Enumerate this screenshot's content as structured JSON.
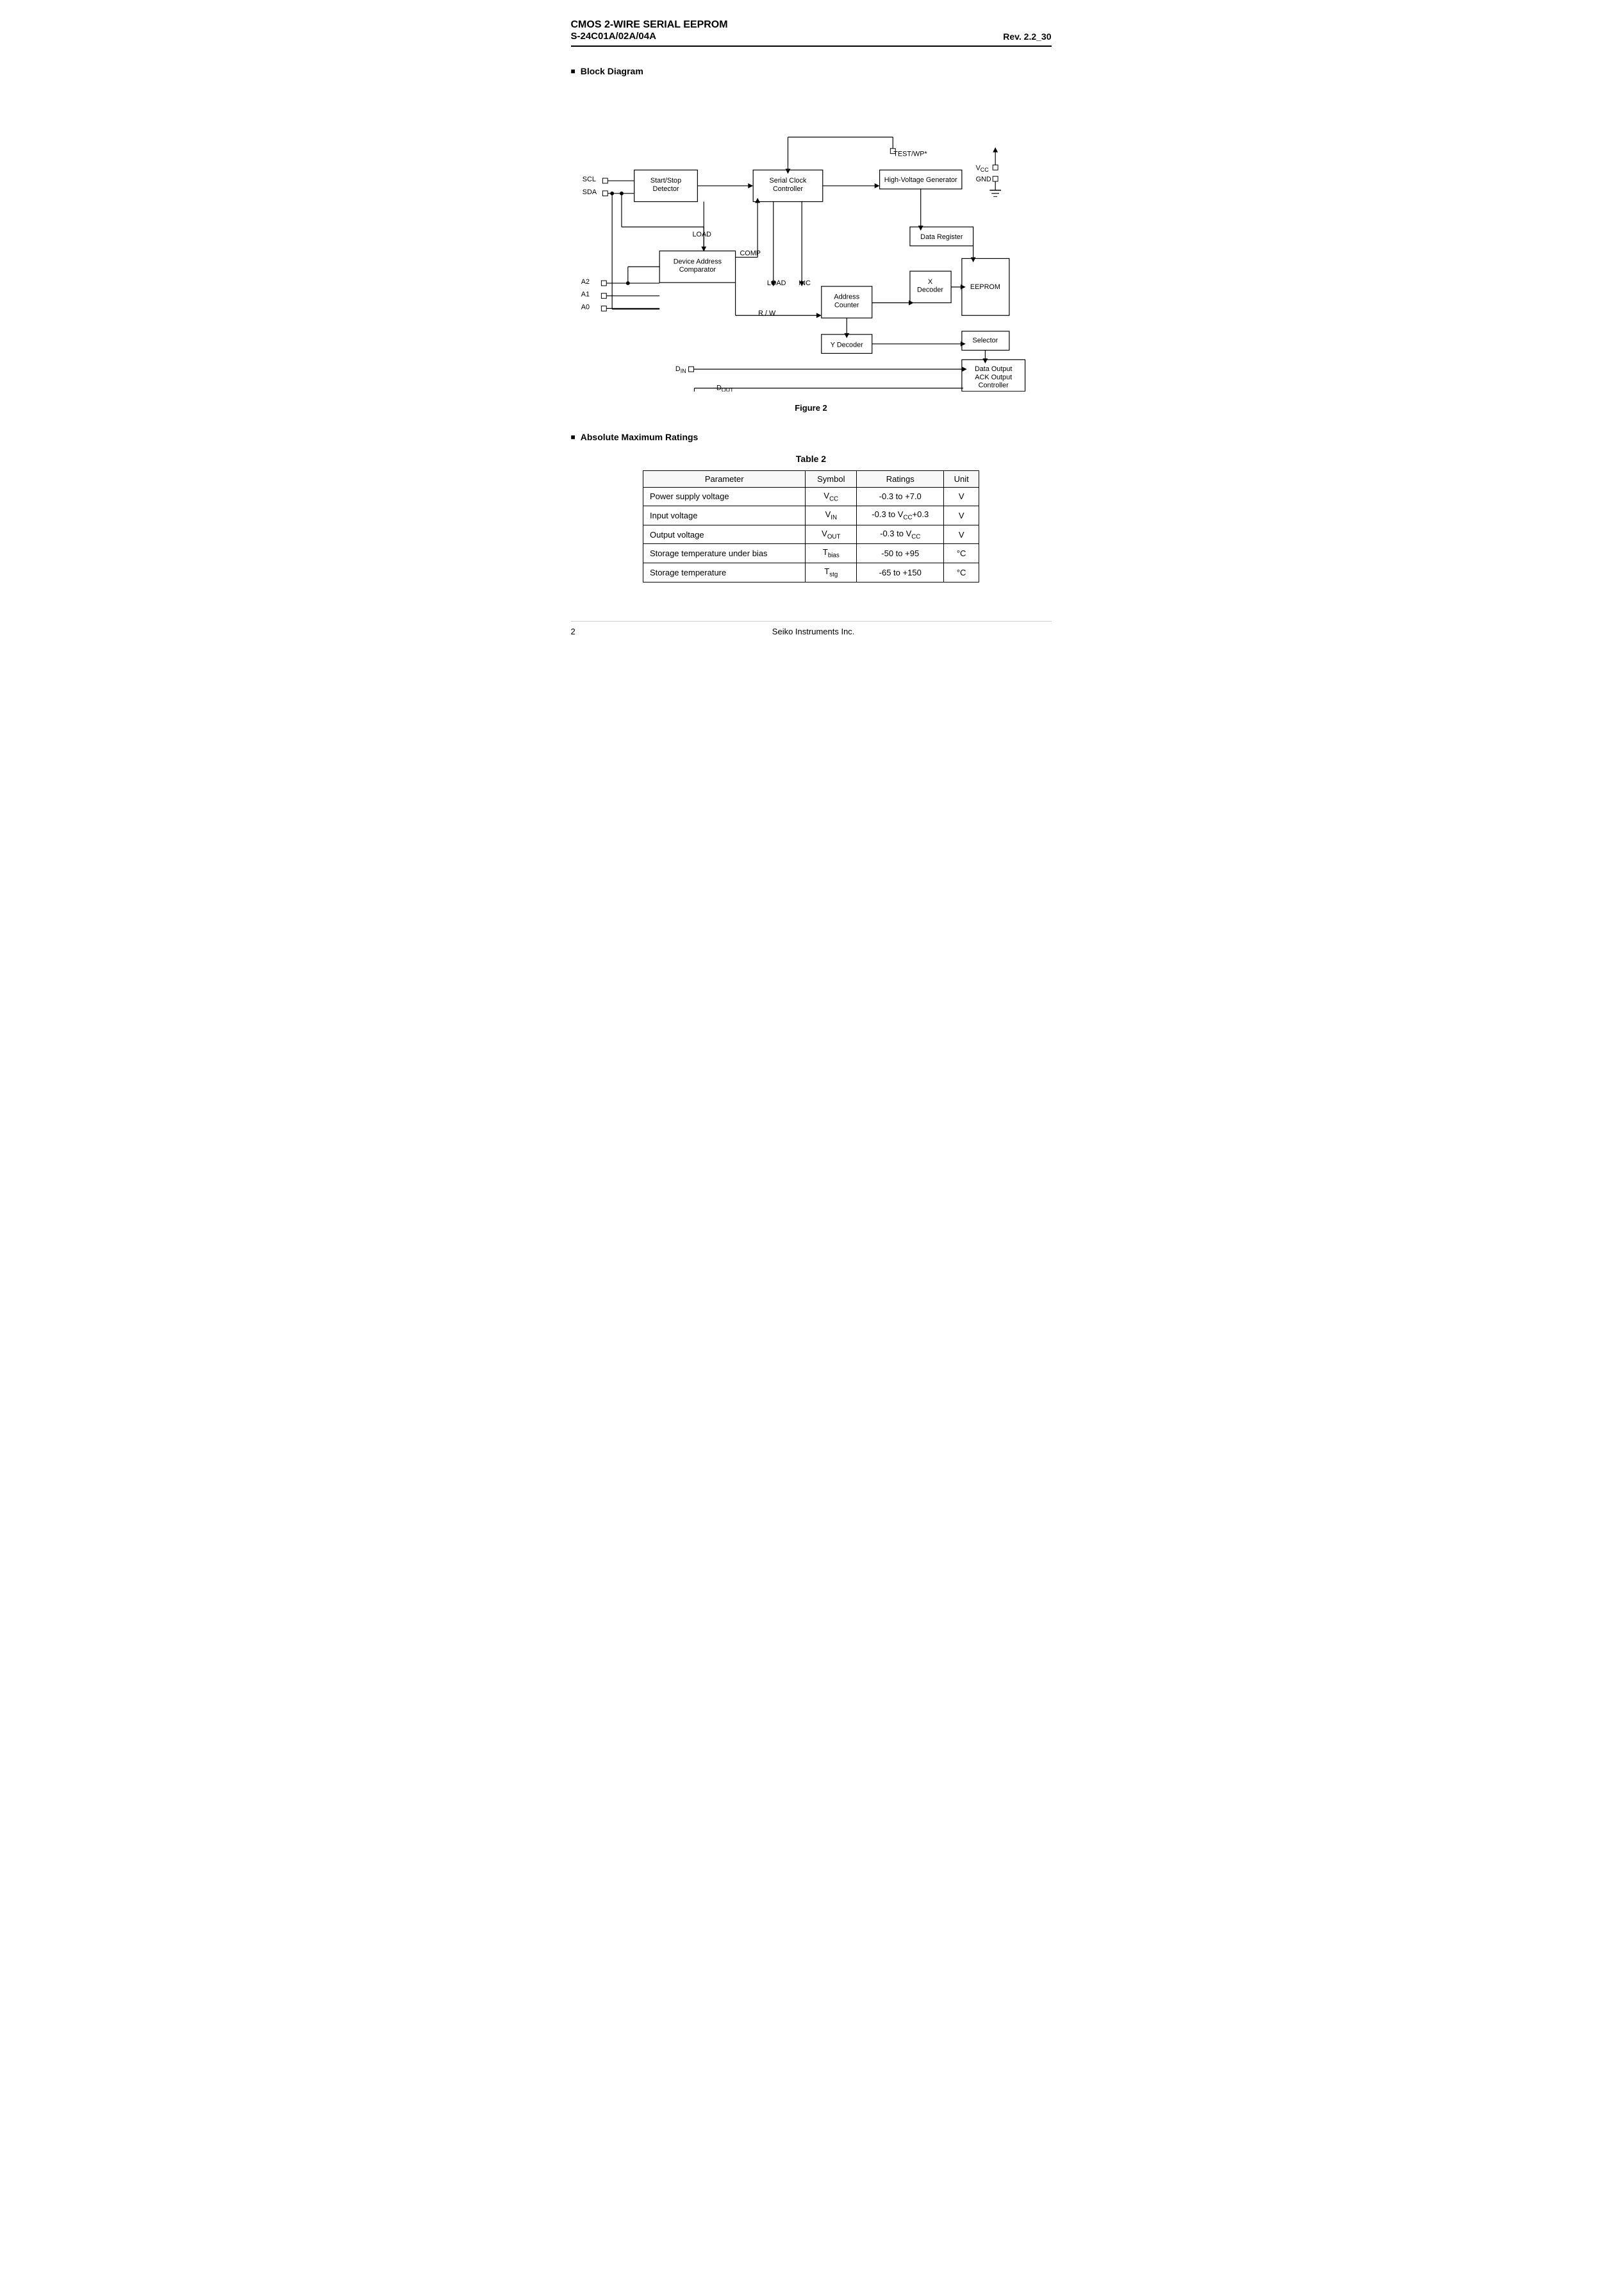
{
  "header": {
    "line1": "CMOS 2-WIRE SERIAL  EEPROM",
    "line2": "S-24C01A/02A/04A",
    "rev": "Rev. 2.2_30"
  },
  "section1": {
    "title": "Block Diagram"
  },
  "figure": {
    "label": "Figure 2"
  },
  "section2": {
    "title": "Absolute Maximum Ratings"
  },
  "table": {
    "label": "Table  2",
    "headers": [
      "Parameter",
      "Symbol",
      "Ratings",
      "Unit"
    ],
    "rows": [
      [
        "Power supply voltage",
        "Vₜc",
        "-0.3 to +7.0",
        "V"
      ],
      [
        "Input voltage",
        "VᴵN",
        "-0.3 to Vₜc+0.3",
        "V"
      ],
      [
        "Output voltage",
        "VₒUT",
        "-0.3 to Vₜc",
        "V"
      ],
      [
        "Storage temperature under bias",
        "Tᵇias",
        "-50 to +95",
        "°C"
      ],
      [
        "Storage temperature",
        "T₝tg",
        "-65 to +150",
        "°C"
      ]
    ]
  },
  "footer": {
    "page": "2",
    "company": "Seiko Instruments Inc."
  }
}
